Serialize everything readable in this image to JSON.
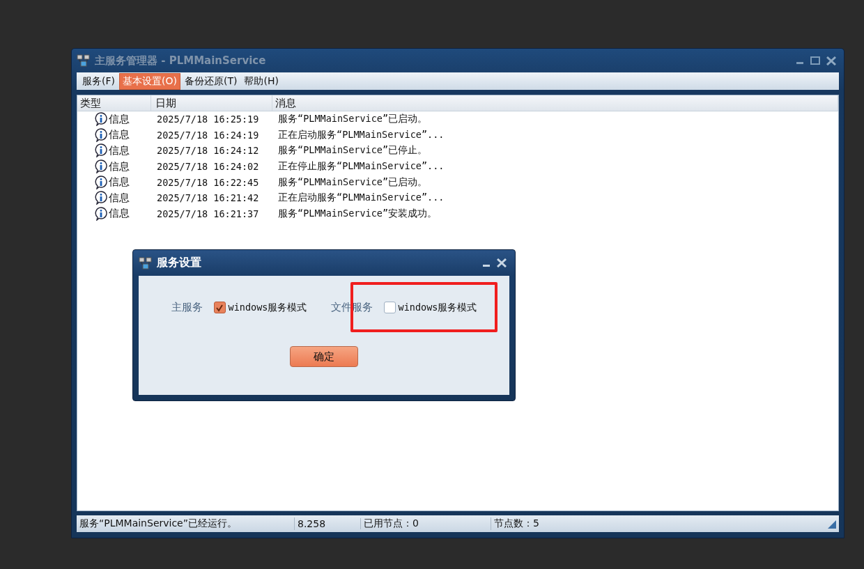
{
  "window": {
    "title": "主服务管理器 - PLMMainService"
  },
  "menu": [
    {
      "label": "服务(F)",
      "selected": false
    },
    {
      "label": "基本设置(O)",
      "selected": true
    },
    {
      "label": "备份还原(T)",
      "selected": false
    },
    {
      "label": "帮助(H)",
      "selected": false
    }
  ],
  "table": {
    "columns": [
      "类型",
      "日期",
      "消息"
    ],
    "rows": [
      {
        "type": "信息",
        "date": "2025/7/18 16:25:19",
        "message": "服务“PLMMainService”已启动。"
      },
      {
        "type": "信息",
        "date": "2025/7/18 16:24:19",
        "message": "正在启动服务“PLMMainService”..."
      },
      {
        "type": "信息",
        "date": "2025/7/18 16:24:12",
        "message": "服务“PLMMainService”已停止。"
      },
      {
        "type": "信息",
        "date": "2025/7/18 16:24:02",
        "message": "正在停止服务“PLMMainService”..."
      },
      {
        "type": "信息",
        "date": "2025/7/18 16:22:45",
        "message": "服务“PLMMainService”已启动。"
      },
      {
        "type": "信息",
        "date": "2025/7/18 16:21:42",
        "message": "正在启动服务“PLMMainService”..."
      },
      {
        "type": "信息",
        "date": "2025/7/18 16:21:37",
        "message": "服务“PLMMainService”安装成功。"
      }
    ]
  },
  "status_bar": [
    "服务“PLMMainService”已经运行。",
    "8.258",
    "已用节点：0",
    "节点数：5"
  ],
  "dialog": {
    "title": "服务设置",
    "options": [
      {
        "label": "主服务",
        "checkbox": "windows服务模式",
        "checked": true,
        "highlighted": false
      },
      {
        "label": "文件服务",
        "checkbox": "windows服务模式",
        "checked": false,
        "highlighted": true
      }
    ],
    "button": "确定"
  }
}
